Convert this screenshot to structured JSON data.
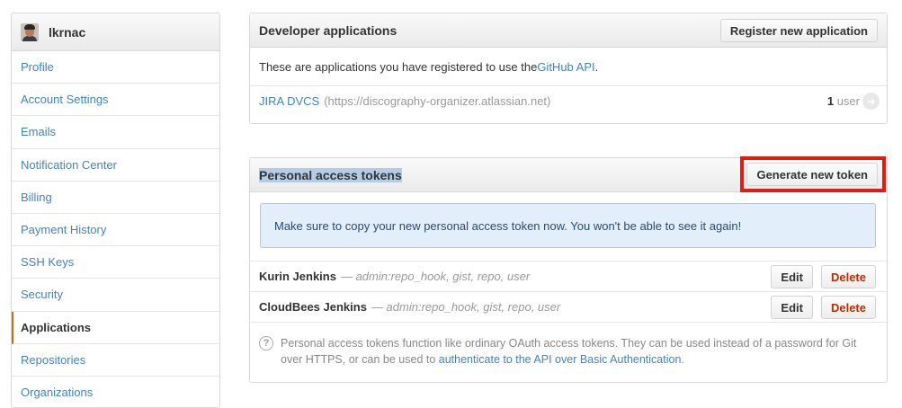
{
  "user": {
    "name": "lkrnac"
  },
  "sidebar": {
    "items": [
      {
        "label": "Profile"
      },
      {
        "label": "Account Settings"
      },
      {
        "label": "Emails"
      },
      {
        "label": "Notification Center"
      },
      {
        "label": "Billing"
      },
      {
        "label": "Payment History"
      },
      {
        "label": "SSH Keys"
      },
      {
        "label": "Security"
      },
      {
        "label": "Applications"
      },
      {
        "label": "Repositories"
      },
      {
        "label": "Organizations"
      }
    ]
  },
  "developer_apps": {
    "title": "Developer applications",
    "register_button": "Register new application",
    "intro_prefix": "These are applications you have registered to use the ",
    "intro_link": "GitHub API",
    "intro_suffix": ".",
    "apps": [
      {
        "name": "JIRA DVCS",
        "url": "(https://discography-organizer.atlassian.net)",
        "user_count": "1",
        "user_label": "user"
      }
    ]
  },
  "tokens": {
    "title": "Personal access tokens",
    "generate_button": "Generate new token",
    "flash": "Make sure to copy your new personal access token now. You won't be able to see it again!",
    "items": [
      {
        "name": "Kurin Jenkins",
        "scopes": "— admin:repo_hook, gist, repo, user",
        "edit": "Edit",
        "delete": "Delete"
      },
      {
        "name": "CloudBees Jenkins",
        "scopes": "— admin:repo_hook, gist, repo, user",
        "edit": "Edit",
        "delete": "Delete"
      }
    ],
    "help_text": "Personal access tokens function like ordinary OAuth access tokens. They can be used instead of a password for Git over HTTPS, or can be used to ",
    "help_link": "authenticate to the API over Basic Authentication",
    "help_suffix": "."
  },
  "colors": {
    "link": "#4183c4",
    "accent_active": "#d26911",
    "highlight": "#e21c0f",
    "danger": "#bd2c00"
  }
}
